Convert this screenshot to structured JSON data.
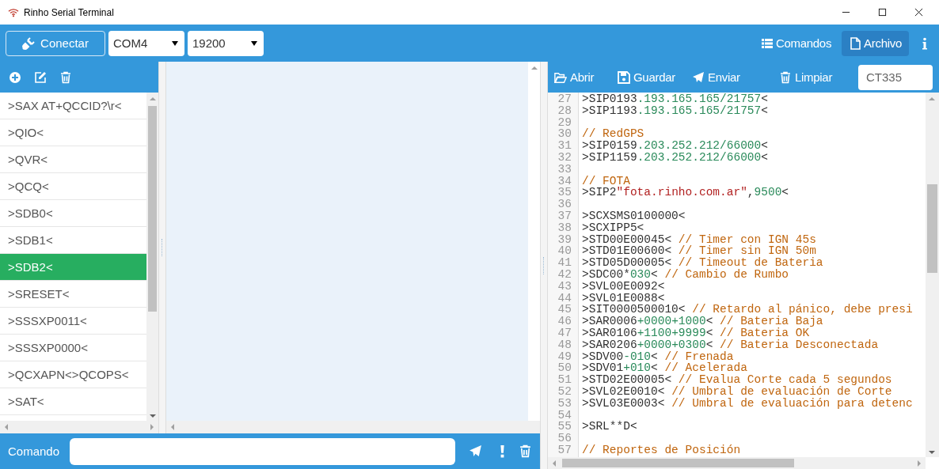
{
  "window": {
    "title": "Rinho Serial Terminal"
  },
  "toolbar": {
    "connect_button": "Conectar",
    "port": "COM4",
    "baud": "19200",
    "tabs": [
      {
        "label": "Comandos",
        "selected": false
      },
      {
        "label": "Archivo",
        "selected": true
      }
    ]
  },
  "commands": {
    "items": [
      {
        "text": ">SAX AT+QCCID?\\r<",
        "selected": false
      },
      {
        "text": ">QIO<",
        "selected": false
      },
      {
        "text": ">QVR<",
        "selected": false
      },
      {
        "text": ">QCQ<",
        "selected": false
      },
      {
        "text": ">SDB0<",
        "selected": false
      },
      {
        "text": ">SDB1<",
        "selected": false
      },
      {
        "text": ">SDB2<",
        "selected": true
      },
      {
        "text": ">SRESET<",
        "selected": false
      },
      {
        "text": ">SSSXP0011<",
        "selected": false
      },
      {
        "text": ">SSSXP0000<",
        "selected": false
      },
      {
        "text": ">QCXAPN<>QCOPS<",
        "selected": false
      },
      {
        "text": ">SAT<",
        "selected": false
      }
    ]
  },
  "file_toolbar": {
    "buttons": [
      "Abrir",
      "Guardar",
      "Enviar",
      "Limpiar"
    ],
    "name_field": "CT335"
  },
  "editor": {
    "lines": [
      {
        "number": "27",
        "parts": [
          {
            "kind": "plain",
            "text": ">SIP0193"
          },
          {
            "kind": "number",
            "text": ".193.165.165/21757"
          },
          {
            "kind": "plain",
            "text": "<"
          }
        ]
      },
      {
        "number": "28",
        "parts": [
          {
            "kind": "plain",
            "text": ">SIP1193"
          },
          {
            "kind": "number",
            "text": ".193.165.165/21757"
          },
          {
            "kind": "plain",
            "text": "<"
          }
        ]
      },
      {
        "number": "29"
      },
      {
        "number": "30",
        "parts": [
          {
            "kind": "comment",
            "text": "// RedGPS"
          }
        ]
      },
      {
        "number": "31",
        "parts": [
          {
            "kind": "plain",
            "text": ">SIP0159"
          },
          {
            "kind": "number",
            "text": ".203.252.212/66000"
          },
          {
            "kind": "plain",
            "text": "<"
          }
        ]
      },
      {
        "number": "32",
        "parts": [
          {
            "kind": "plain",
            "text": ">SIP1159"
          },
          {
            "kind": "number",
            "text": ".203.252.212/66000"
          },
          {
            "kind": "plain",
            "text": "<"
          }
        ]
      },
      {
        "number": "33"
      },
      {
        "number": "34",
        "parts": [
          {
            "kind": "comment",
            "text": "// FOTA"
          }
        ]
      },
      {
        "number": "35",
        "parts": [
          {
            "kind": "plain",
            "text": ">SIP2"
          },
          {
            "kind": "string",
            "text": "\"fota.rinho.com.ar\""
          },
          {
            "kind": "plain",
            "text": ","
          },
          {
            "kind": "number",
            "text": "9500"
          },
          {
            "kind": "plain",
            "text": "<"
          }
        ]
      },
      {
        "number": "36"
      },
      {
        "number": "37",
        "parts": [
          {
            "kind": "plain",
            "text": ">SCXSMS0100000<"
          }
        ]
      },
      {
        "number": "38",
        "parts": [
          {
            "kind": "plain",
            "text": ">SCXIPP5<"
          }
        ]
      },
      {
        "number": "39",
        "parts": [
          {
            "kind": "plain",
            "text": ">STD00E00045< "
          },
          {
            "kind": "comment",
            "text": "// Timer con IGN 45s"
          }
        ]
      },
      {
        "number": "40",
        "parts": [
          {
            "kind": "plain",
            "text": ">STD01E00600< "
          },
          {
            "kind": "comment",
            "text": "// Timer sin IGN 50m"
          }
        ]
      },
      {
        "number": "41",
        "parts": [
          {
            "kind": "plain",
            "text": ">STD05D00005< "
          },
          {
            "kind": "comment",
            "text": "// Timeout de Bateria"
          }
        ]
      },
      {
        "number": "42",
        "parts": [
          {
            "kind": "plain",
            "text": ">SDC00*"
          },
          {
            "kind": "number",
            "text": "030"
          },
          {
            "kind": "plain",
            "text": "< "
          },
          {
            "kind": "comment",
            "text": "// Cambio de Rumbo"
          }
        ]
      },
      {
        "number": "43",
        "parts": [
          {
            "kind": "plain",
            "text": ">SVL00E0092<"
          }
        ]
      },
      {
        "number": "44",
        "parts": [
          {
            "kind": "plain",
            "text": ">SVL01E0088<"
          }
        ]
      },
      {
        "number": "45",
        "parts": [
          {
            "kind": "plain",
            "text": ">SIT0000500010< "
          },
          {
            "kind": "comment",
            "text": "// Retardo al pánico, debe presi"
          }
        ]
      },
      {
        "number": "46",
        "parts": [
          {
            "kind": "plain",
            "text": ">SAR0006"
          },
          {
            "kind": "number",
            "text": "+0000+1000"
          },
          {
            "kind": "plain",
            "text": "< "
          },
          {
            "kind": "comment",
            "text": "// Bateria Baja"
          }
        ]
      },
      {
        "number": "47",
        "parts": [
          {
            "kind": "plain",
            "text": ">SAR0106"
          },
          {
            "kind": "number",
            "text": "+1100+9999"
          },
          {
            "kind": "plain",
            "text": "< "
          },
          {
            "kind": "comment",
            "text": "// Bateria OK"
          }
        ]
      },
      {
        "number": "48",
        "parts": [
          {
            "kind": "plain",
            "text": ">SAR0206"
          },
          {
            "kind": "number",
            "text": "+0000+0300"
          },
          {
            "kind": "plain",
            "text": "< "
          },
          {
            "kind": "comment",
            "text": "// Bateria Desconectada"
          }
        ]
      },
      {
        "number": "49",
        "parts": [
          {
            "kind": "plain",
            "text": ">SDV00"
          },
          {
            "kind": "number",
            "text": "-010"
          },
          {
            "kind": "plain",
            "text": "< "
          },
          {
            "kind": "comment",
            "text": "// Frenada"
          }
        ]
      },
      {
        "number": "50",
        "parts": [
          {
            "kind": "plain",
            "text": ">SDV01"
          },
          {
            "kind": "number",
            "text": "+010"
          },
          {
            "kind": "plain",
            "text": "< "
          },
          {
            "kind": "comment",
            "text": "// Acelerada"
          }
        ]
      },
      {
        "number": "51",
        "parts": [
          {
            "kind": "plain",
            "text": ">STD02E00005< "
          },
          {
            "kind": "comment",
            "text": "// Evalua Corte cada 5 segundos"
          }
        ]
      },
      {
        "number": "52",
        "parts": [
          {
            "kind": "plain",
            "text": ">SVL02E0010< "
          },
          {
            "kind": "comment",
            "text": "// Umbral de evaluación de Corte"
          }
        ]
      },
      {
        "number": "53",
        "parts": [
          {
            "kind": "plain",
            "text": ">SVL03E0003< "
          },
          {
            "kind": "comment",
            "text": "// Umbral de evaluación para detenc"
          }
        ]
      },
      {
        "number": "54"
      },
      {
        "number": "55",
        "parts": [
          {
            "kind": "plain",
            "text": ">SRL**D<"
          }
        ]
      },
      {
        "number": "56"
      },
      {
        "number": "57",
        "parts": [
          {
            "kind": "comment",
            "text": "// Reportes de Posición"
          }
        ]
      }
    ]
  },
  "command_bar": {
    "label": "Comando"
  }
}
